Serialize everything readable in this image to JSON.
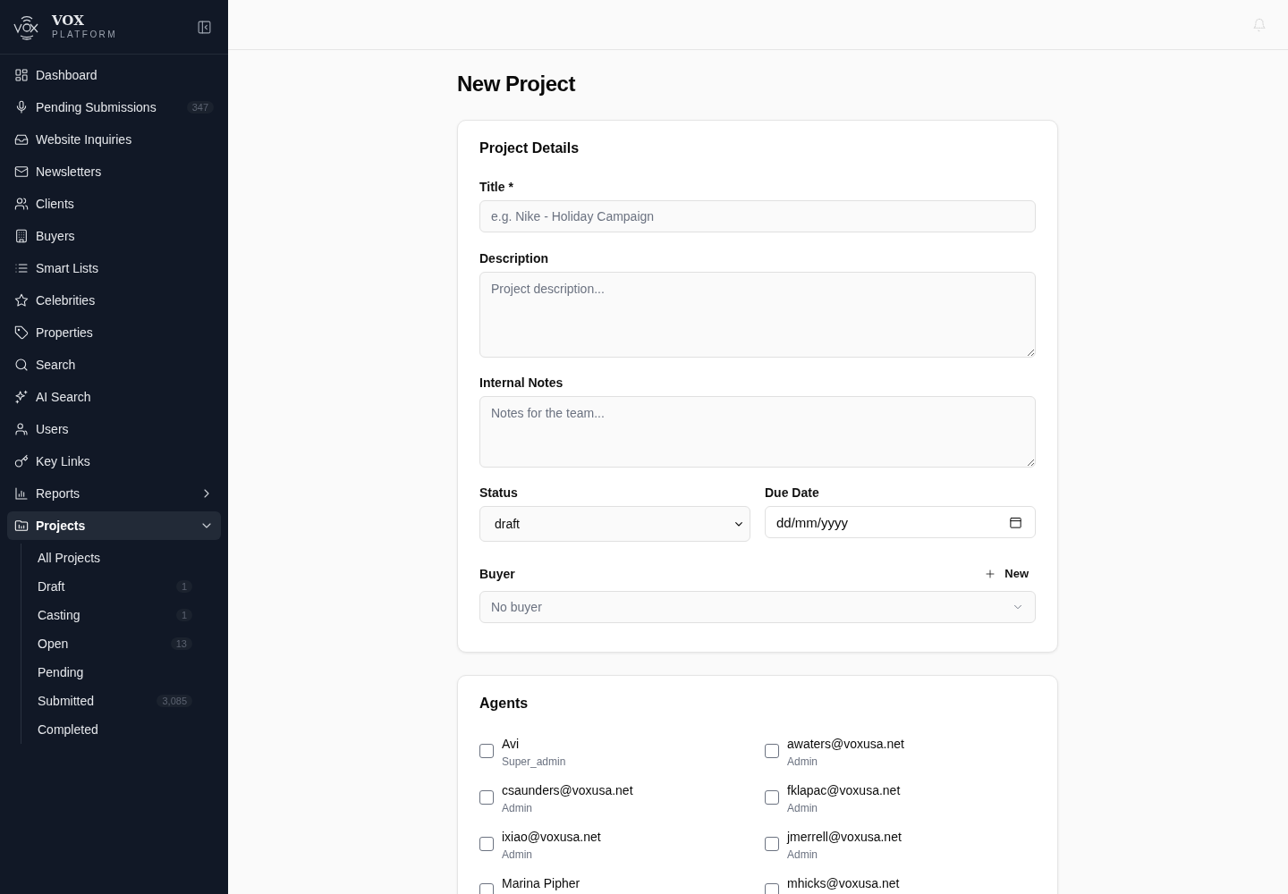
{
  "brand": {
    "name": "VOX",
    "tagline": "PLATFORM"
  },
  "nav": [
    {
      "label": "Dashboard",
      "selected": false
    },
    {
      "label": "Pending Submissions",
      "badge": "347",
      "selected": false
    },
    {
      "label": "Website Inquiries",
      "selected": false
    },
    {
      "label": "Newsletters",
      "selected": false
    },
    {
      "label": "Clients",
      "selected": false
    },
    {
      "label": "Buyers",
      "selected": false
    },
    {
      "label": "Smart Lists",
      "selected": false
    },
    {
      "label": "Celebrities",
      "selected": false
    },
    {
      "label": "Properties",
      "selected": false
    },
    {
      "label": "Search",
      "selected": false
    },
    {
      "label": "AI Search",
      "selected": false
    },
    {
      "label": "Users",
      "selected": false
    },
    {
      "label": "Key Links",
      "selected": false
    },
    {
      "label": "Reports",
      "selected": false,
      "expanded": false
    },
    {
      "label": "Projects",
      "selected": true,
      "expanded": true,
      "children": [
        {
          "label": "All Projects",
          "selected": false
        },
        {
          "label": "Draft",
          "badge": "1",
          "selected": false
        },
        {
          "label": "Casting",
          "badge": "1",
          "selected": false
        },
        {
          "label": "Open",
          "badge": "13",
          "selected": false
        },
        {
          "label": "Pending",
          "selected": false
        },
        {
          "label": "Submitted",
          "badge": "3,085",
          "selected": false
        },
        {
          "label": "Completed",
          "selected": false
        }
      ]
    }
  ],
  "page_title": "New Project",
  "details": {
    "heading": "Project Details",
    "title": {
      "label": "Title *",
      "placeholder": "e.g. Nike - Holiday Campaign"
    },
    "description": {
      "label": "Description",
      "placeholder": "Project description..."
    },
    "notes": {
      "label": "Internal Notes",
      "placeholder": "Notes for the team..."
    },
    "status": {
      "label": "Status",
      "value": "draft"
    },
    "due_date": {
      "label": "Due Date",
      "placeholder": "dd/mm/yyyy"
    },
    "buyer": {
      "label": "Buyer",
      "new_button": "New",
      "placeholder": "No buyer"
    }
  },
  "agents": {
    "heading": "Agents",
    "items": [
      {
        "name": "Avi",
        "role": "Super_admin",
        "checked": false
      },
      {
        "name": "awaters@voxusa.net",
        "role": "Admin",
        "checked": false
      },
      {
        "name": "csaunders@voxusa.net",
        "role": "Admin",
        "checked": false
      },
      {
        "name": "fklapac@voxusa.net",
        "role": "Admin",
        "checked": false
      },
      {
        "name": "ixiao@voxusa.net",
        "role": "Admin",
        "checked": false
      },
      {
        "name": "jmerrell@voxusa.net",
        "role": "Admin",
        "checked": false
      },
      {
        "name": "Marina Pipher",
        "checked": false
      },
      {
        "name": "mhicks@voxusa.net",
        "checked": false
      }
    ]
  }
}
